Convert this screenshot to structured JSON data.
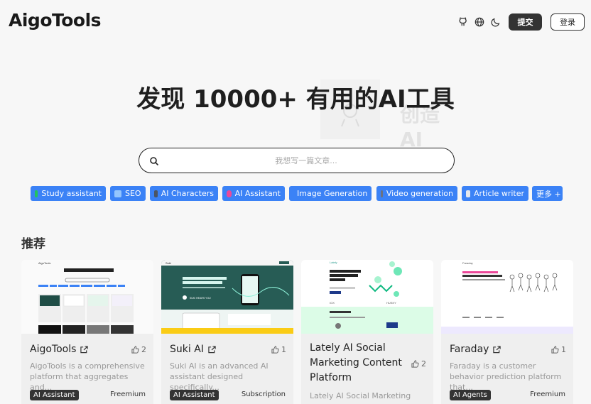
{
  "header": {
    "logo": "AigoTools",
    "icons": [
      "github-icon",
      "globe-icon",
      "moon-icon"
    ],
    "submit_label": "提交",
    "login_label": "登录"
  },
  "watermark": {
    "text": "创造AI"
  },
  "hero": {
    "title": "发现 10000+ 有用的AI工具"
  },
  "search": {
    "placeholder": "我想写一篇文章..."
  },
  "tags": [
    {
      "label": "Study assistant",
      "color": "#22c55e"
    },
    {
      "label": "SEO",
      "color": "#60a5fa"
    },
    {
      "label": "AI Characters",
      "color": "#4b5563"
    },
    {
      "label": "AI Assistant",
      "color": "#ec4899"
    },
    {
      "label": "Image Generation",
      "color": "#ef4444"
    },
    {
      "label": "Video generation",
      "color": "#6b7280"
    },
    {
      "label": "Article writer",
      "color": "#e5e7eb"
    },
    {
      "label": "更多 +",
      "color": ""
    }
  ],
  "section": {
    "title": "推荐"
  },
  "cards": [
    {
      "name": "AigoTools",
      "likes": "2",
      "desc": "AigoTools is a comprehensive platform that aggregates and...",
      "badge": "AI Assistant",
      "pricing": "Freemium"
    },
    {
      "name": "Suki AI",
      "likes": "1",
      "desc": "Suki AI is an advanced AI assistant designed specifically...",
      "badge": "AI Assistant",
      "pricing": "Subscription"
    },
    {
      "name": "Lately AI Social Marketing Content Platform",
      "likes": "2",
      "desc": "Lately AI Social Marketing",
      "badge": "",
      "pricing": ""
    },
    {
      "name": "Faraday",
      "likes": "1",
      "desc": "Faraday is a customer behavior prediction platform that...",
      "badge": "AI Agents",
      "pricing": "Freemium"
    }
  ]
}
